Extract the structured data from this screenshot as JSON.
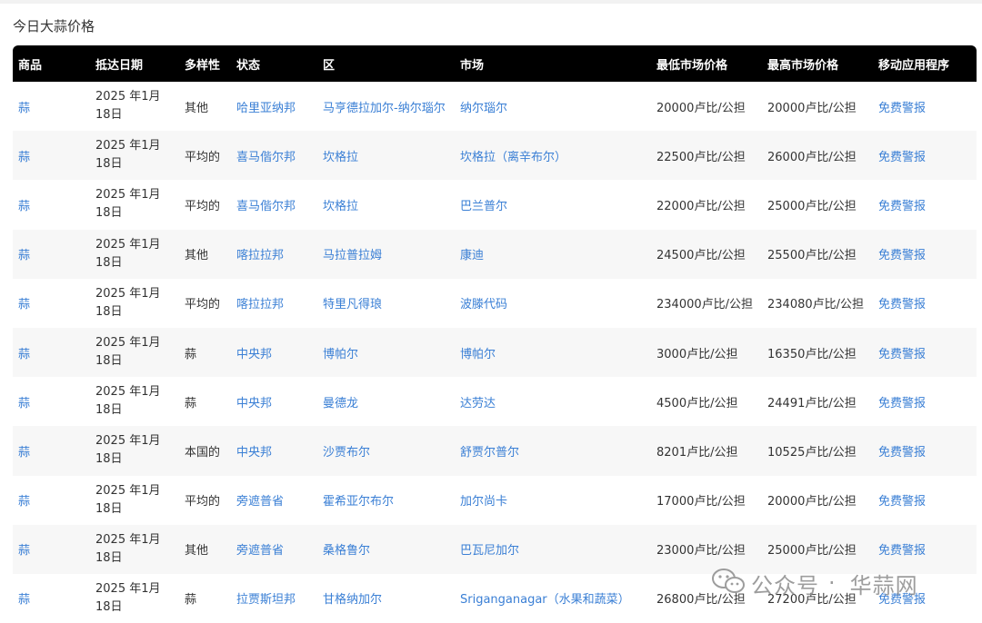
{
  "page": {
    "title": "今日大蒜价格"
  },
  "table": {
    "headers": [
      "商品",
      "抵达日期",
      "多样性",
      "状态",
      "区",
      "市场",
      "最低市场价格",
      "最高市场价格",
      "移动应用程序"
    ],
    "rows": [
      {
        "commodity": "蒜",
        "date": "2025 年1月18日",
        "variety": "其他",
        "state": "哈里亚纳邦",
        "district": "马亨德拉加尔-纳尔瑙尔",
        "market": "纳尔瑙尔",
        "min": "20000卢比/公担",
        "max": "20000卢比/公担",
        "app": "免费警报"
      },
      {
        "commodity": "蒜",
        "date": "2025 年1月18日",
        "variety": "平均的",
        "state": "喜马偕尔邦",
        "district": "坎格拉",
        "market": "坎格拉（离辛布尔）",
        "min": "22500卢比/公担",
        "max": "26000卢比/公担",
        "app": "免费警报"
      },
      {
        "commodity": "蒜",
        "date": "2025 年1月18日",
        "variety": "平均的",
        "state": "喜马偕尔邦",
        "district": "坎格拉",
        "market": "巴兰普尔",
        "min": "22000卢比/公担",
        "max": "25000卢比/公担",
        "app": "免费警报"
      },
      {
        "commodity": "蒜",
        "date": "2025 年1月18日",
        "variety": "其他",
        "state": "喀拉拉邦",
        "district": "马拉普拉姆",
        "market": "康迪",
        "min": "24500卢比/公担",
        "max": "25500卢比/公担",
        "app": "免费警报"
      },
      {
        "commodity": "蒜",
        "date": "2025 年1月18日",
        "variety": "平均的",
        "state": "喀拉拉邦",
        "district": "特里凡得琅",
        "market": "波滕代码",
        "min": "234000卢比/公担",
        "max": "234080卢比/公担",
        "app": "免费警报"
      },
      {
        "commodity": "蒜",
        "date": "2025 年1月18日",
        "variety": "蒜",
        "state": "中央邦",
        "district": "博帕尔",
        "market": "博帕尔",
        "min": "3000卢比/公担",
        "max": "16350卢比/公担",
        "app": "免费警报"
      },
      {
        "commodity": "蒜",
        "date": "2025 年1月18日",
        "variety": "蒜",
        "state": "中央邦",
        "district": "曼德龙",
        "market": "达劳达",
        "min": "4500卢比/公担",
        "max": "24491卢比/公担",
        "app": "免费警报"
      },
      {
        "commodity": "蒜",
        "date": "2025 年1月18日",
        "variety": "本国的",
        "state": "中央邦",
        "district": "沙贾布尔",
        "market": "舒贾尔普尔",
        "min": "8201卢比/公担",
        "max": "10525卢比/公担",
        "app": "免费警报"
      },
      {
        "commodity": "蒜",
        "date": "2025 年1月18日",
        "variety": "平均的",
        "state": "旁遮普省",
        "district": "霍希亚尔布尔",
        "market": "加尔尚卡",
        "min": "17000卢比/公担",
        "max": "20000卢比/公担",
        "app": "免费警报"
      },
      {
        "commodity": "蒜",
        "date": "2025 年1月18日",
        "variety": "其他",
        "state": "旁遮普省",
        "district": "桑格鲁尔",
        "market": "巴瓦尼加尔",
        "min": "23000卢比/公担",
        "max": "25000卢比/公担",
        "app": "免费警报"
      },
      {
        "commodity": "蒜",
        "date": "2025 年1月18日",
        "variety": "蒜",
        "state": "拉贾斯坦邦",
        "district": "甘格纳加尔",
        "market": "Sriganganagar（水果和蔬菜）",
        "min": "26800卢比/公担",
        "max": "27200卢比/公担",
        "app": "免费警报"
      }
    ]
  },
  "watermark": {
    "icon": "wechat-icon",
    "account": "公众号",
    "name": "华蒜网"
  },
  "colors": {
    "header_bg": "#000000",
    "link": "#3a7fd5",
    "stripe": "#f7f7f7"
  }
}
